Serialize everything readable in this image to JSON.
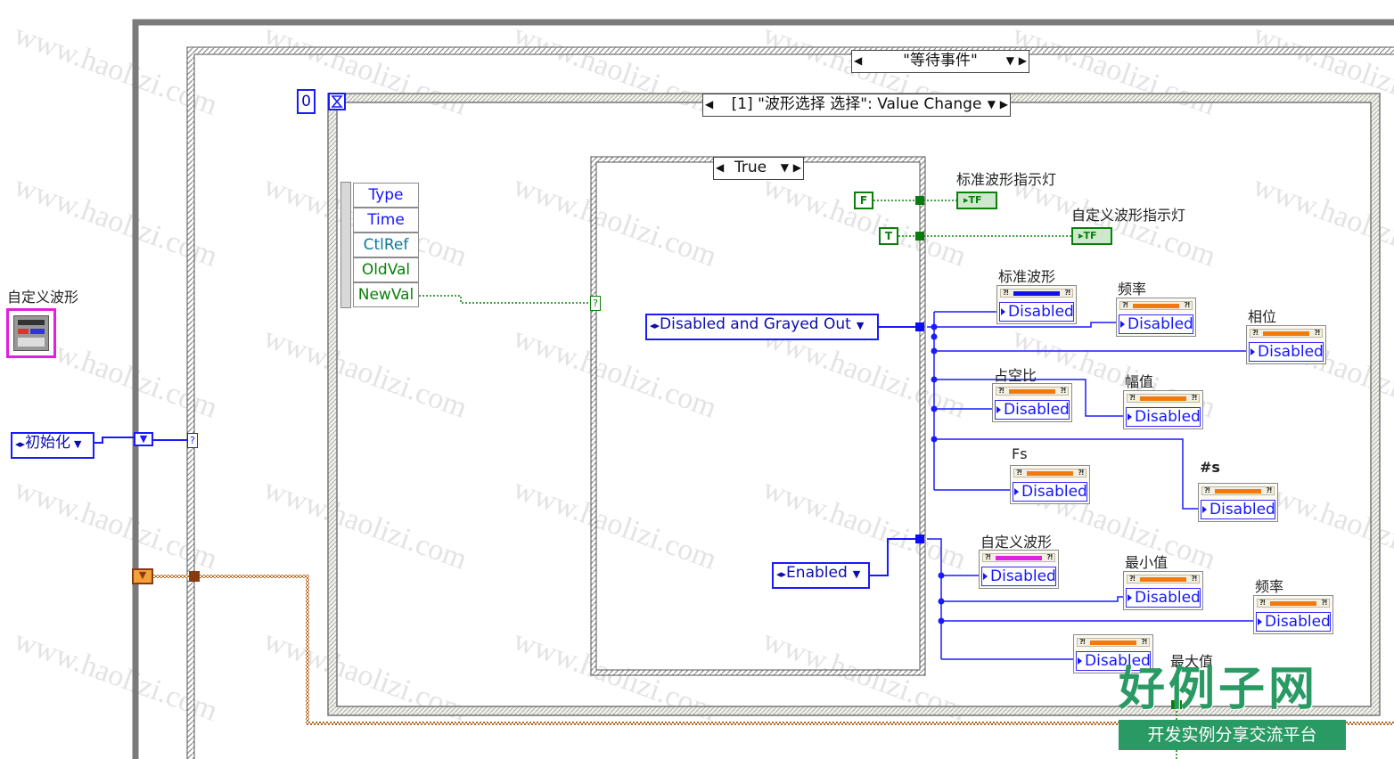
{
  "watermark": {
    "text": "www.haolizi.com"
  },
  "logo": {
    "main": "好例子网",
    "sub": "开发实例分享交流平台"
  },
  "palette": {
    "int_wire": "#0000ff",
    "bool_wire": "#0a800a",
    "error_wire": "#b5651d",
    "frame_gray": "#808080"
  },
  "left_panel": {
    "custom_wave_label": "自定义波形",
    "init_enum": "初始化",
    "shift_arrow_down": "▼",
    "case_terminal": "?"
  },
  "while_loop": {
    "case_selector": "\"等待事件\""
  },
  "event_structure": {
    "timeout_const": "0",
    "timeout_icon": "hourglass",
    "event_selector": "[1] \"波形选择 选择\": Value Change",
    "event_data": [
      "Type",
      "Time",
      "CtlRef",
      "OldVal",
      "NewVal"
    ]
  },
  "case_structure": {
    "selector": "True",
    "selector_terminal": "?",
    "const_disabled": "Disabled and Grayed Out",
    "const_enabled": "Enabled",
    "bool_false": "F",
    "bool_true": "T"
  },
  "indicators": {
    "std_wave_light_label": "标准波形指示灯",
    "custom_wave_light_label": "自定义波形指示灯",
    "tf_text": "TF",
    "std_wave": {
      "label": "标准波形",
      "value": "Disabled"
    },
    "freq1": {
      "label": "频率",
      "value": "Disabled"
    },
    "phase": {
      "label": "相位",
      "value": "Disabled"
    },
    "duty": {
      "label": "占空比",
      "value": "Disabled"
    },
    "amp": {
      "label": "幅值",
      "value": "Disabled"
    },
    "fs": {
      "label": "Fs",
      "value": "Disabled"
    },
    "ns": {
      "label": "#s",
      "value": "Disabled"
    },
    "custom_wave": {
      "label": "自定义波形",
      "value": "Disabled"
    },
    "minv": {
      "label": "最小值",
      "value": "Disabled"
    },
    "freq2": {
      "label": "频率",
      "value": "Disabled"
    },
    "maxv": {
      "label": "最大值",
      "value": "Disabled"
    }
  }
}
